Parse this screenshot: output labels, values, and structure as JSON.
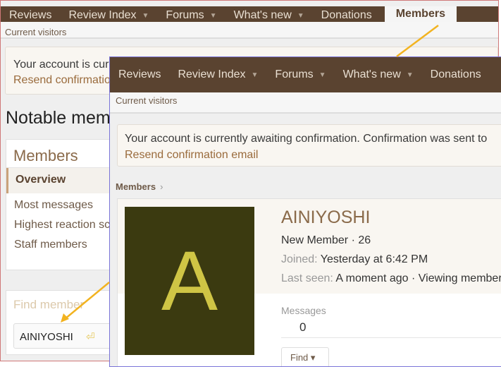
{
  "back": {
    "nav": [
      {
        "label": "Reviews",
        "caret": false
      },
      {
        "label": "Review Index",
        "caret": true
      },
      {
        "label": "Forums",
        "caret": true
      },
      {
        "label": "What's new",
        "caret": true
      },
      {
        "label": "Donations",
        "caret": false
      },
      {
        "label": "Members",
        "caret": false,
        "active": true
      }
    ],
    "subnav": "Current visitors",
    "notice": "Your account is currently awaiting confirmation. Confirmation was sent to",
    "resend": "Resend confirmation email",
    "title": "Notable members",
    "sidebar_title": "Members",
    "sidebar": [
      "Overview",
      "Most messages",
      "Highest reaction score",
      "Staff members"
    ],
    "find_title": "Find member",
    "find_value": "AINIYOSHI"
  },
  "front": {
    "nav": [
      {
        "label": "Reviews",
        "caret": false
      },
      {
        "label": "Review Index",
        "caret": true
      },
      {
        "label": "Forums",
        "caret": true
      },
      {
        "label": "What's new",
        "caret": true
      },
      {
        "label": "Donations",
        "caret": false
      }
    ],
    "subnav": "Current visitors",
    "notice": "Your account is currently awaiting confirmation. Confirmation was sent to",
    "resend": "Resend confirmation email",
    "breadcrumb": "Members",
    "avatar_letter": "A",
    "username": "AINIYOSHI",
    "title_line": "New Member · 26",
    "joined_label": "Joined:",
    "joined_value": "Yesterday at 6:42 PM",
    "lastseen_label": "Last seen:",
    "lastseen_value": "A moment ago · Viewing member profile",
    "messages_label": "Messages",
    "messages_value": "0",
    "find_button": "Find ▾"
  },
  "colors": {
    "nav": "#5a4330",
    "avatar_bg": "#3b3a10",
    "avatar_fg": "#cfc545",
    "arrow": "#f2b320"
  }
}
